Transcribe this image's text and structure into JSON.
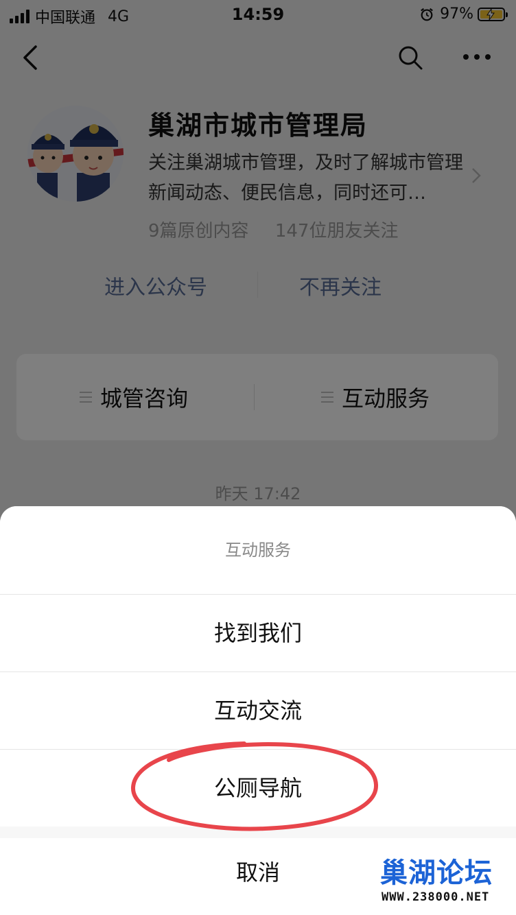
{
  "status_bar": {
    "carrier": "中国联通",
    "network": "4G",
    "time": "14:59",
    "battery": "97%",
    "battery_color": "#f6c431"
  },
  "nav": {
    "back_icon": "chevron-left-icon",
    "search_icon": "search-icon",
    "more_icon": "more-dots-icon"
  },
  "account": {
    "name": "巢湖市城市管理局",
    "description": "关注巢湖城市管理，及时了解城市管理新闻动态、便民信息，同时还可…",
    "original_count": "9篇原创内容",
    "followers": "147位朋友关注",
    "enter_label": "进入公众号",
    "unfollow_label": "不再关注",
    "link_color": "#576b95"
  },
  "menu": {
    "items": [
      {
        "label": "城管咨询"
      },
      {
        "label": "互动服务"
      }
    ]
  },
  "timestamp": "昨天 17:42",
  "action_sheet": {
    "title": "互动服务",
    "options": [
      {
        "label": "找到我们"
      },
      {
        "label": "互动交流"
      },
      {
        "label": "公厕导航"
      }
    ],
    "cancel_label": "取消",
    "highlight_color": "#e8454b"
  },
  "watermark": {
    "logo": "巢湖论坛",
    "url": "WWW.238000.NET"
  }
}
